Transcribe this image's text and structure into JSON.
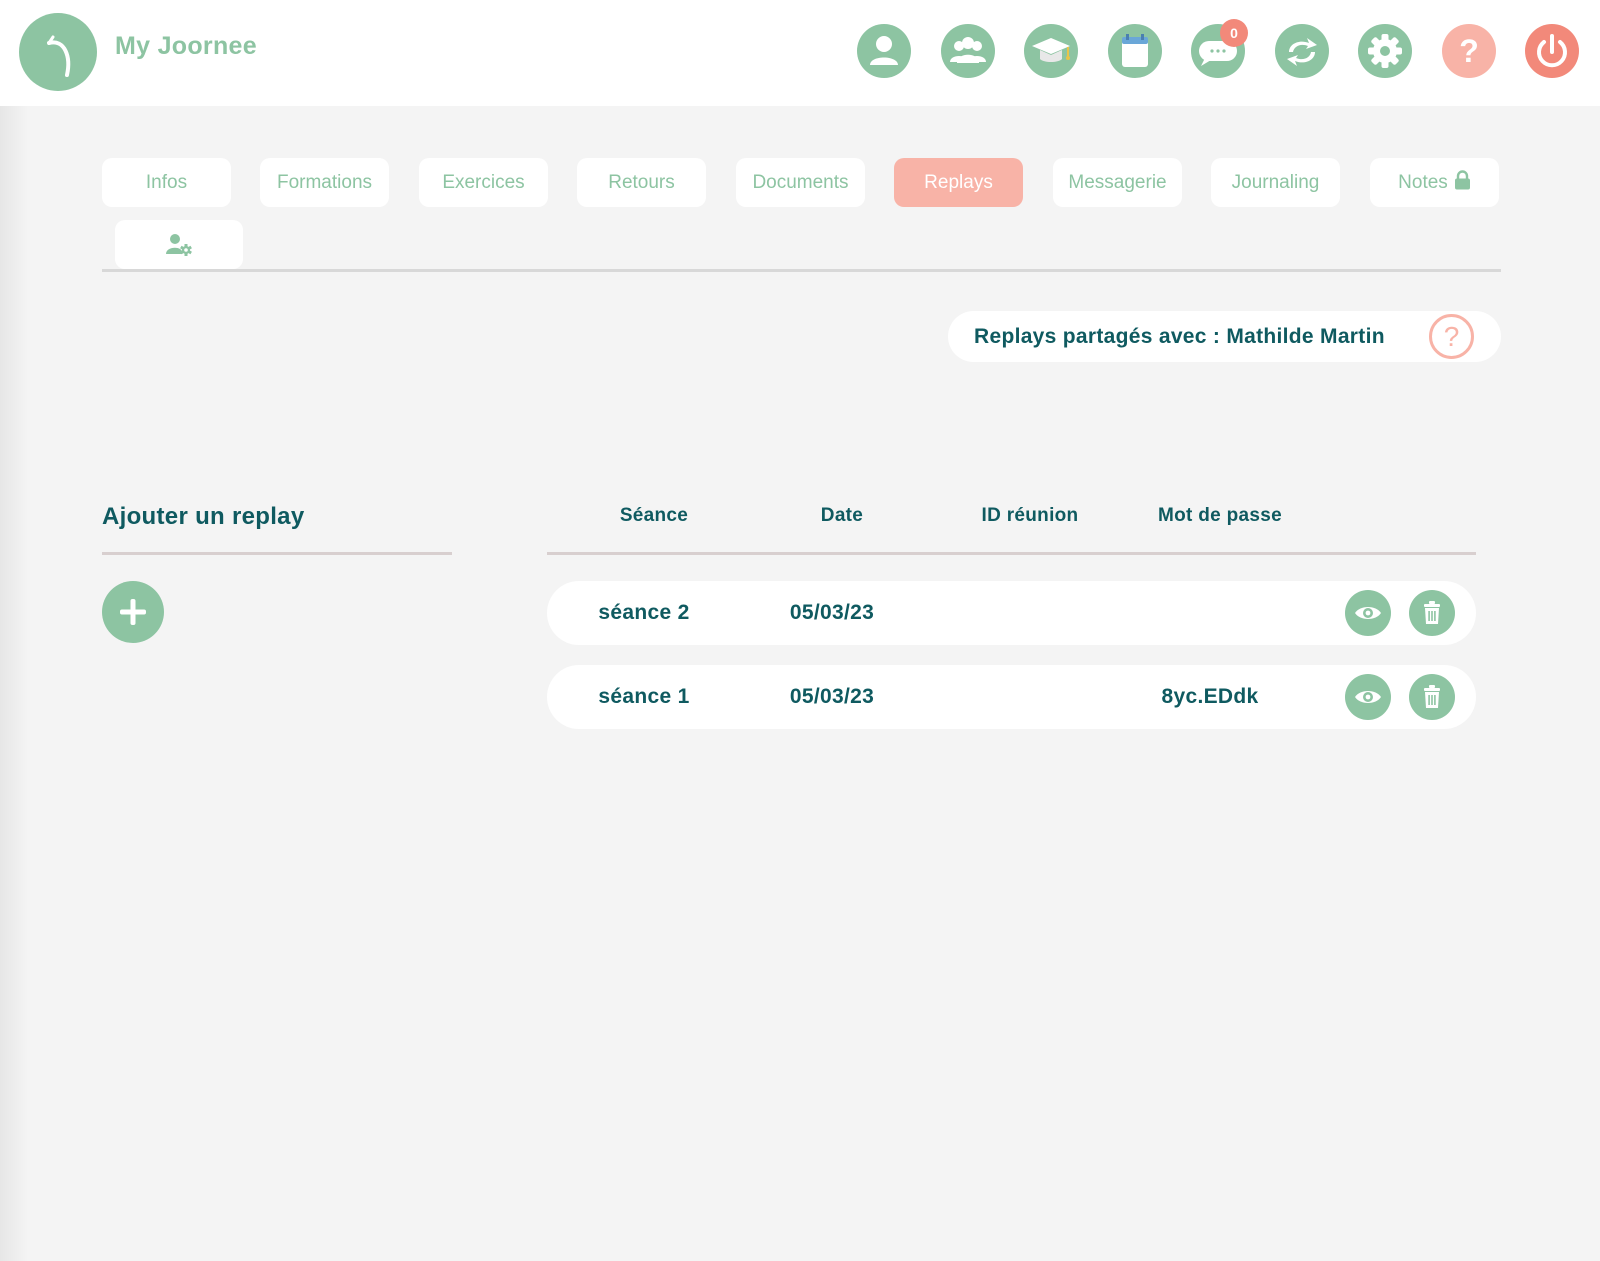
{
  "header": {
    "app_title": "My Joornee",
    "nav_icons": [
      "profile-icon",
      "group-icon",
      "graduation-cap-icon",
      "calendar-icon",
      "chat-icon",
      "sync-icon",
      "gear-icon",
      "help-icon",
      "power-icon"
    ],
    "chat_badge": "0"
  },
  "tabs": [
    {
      "label": "Infos"
    },
    {
      "label": "Formations"
    },
    {
      "label": "Exercices"
    },
    {
      "label": "Retours"
    },
    {
      "label": "Documents"
    },
    {
      "label": "Replays",
      "active": true
    },
    {
      "label": "Messagerie"
    },
    {
      "label": "Journaling"
    },
    {
      "label": "Notes",
      "icon": "lock-icon"
    }
  ],
  "tab_row2_icon": "user-settings-icon",
  "shared": {
    "text": "Replays partagés avec : Mathilde Martin",
    "help_symbol": "?"
  },
  "add_section": {
    "title": "Ajouter un replay",
    "button_icon": "plus-icon"
  },
  "table": {
    "headers": {
      "seance": "Séance",
      "date": "Date",
      "id_reunion": "ID réunion",
      "mot_de_passe": "Mot de passe"
    },
    "rows": [
      {
        "seance": "séance 2",
        "date": "05/03/23",
        "id_reunion": "",
        "mot_de_passe": ""
      },
      {
        "seance": "séance 1",
        "date": "05/03/23",
        "id_reunion": "",
        "mot_de_passe": "8yc.EDdk"
      }
    ]
  },
  "colors": {
    "green": "#8dc4a2",
    "salmon": "#f8b3a7",
    "coral": "#f2897a",
    "dark_teal": "#0f5a60",
    "background": "#f4f4f4"
  }
}
